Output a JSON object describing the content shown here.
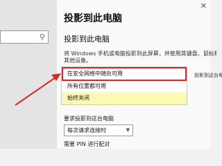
{
  "main": {
    "page_title": "投影到此电脑",
    "section_title": "投影到此电脑",
    "description_line1": "将 Windows 手机或电脑投影到此屏幕，并使用其键盘、鼠标和",
    "description_line2": "其他设备。",
    "right_clipped_text": "投影到这台电"
  },
  "dropdown": {
    "options": [
      "在安全网络中随处可用",
      "所有位置都可用",
      "始终关闭"
    ]
  },
  "request": {
    "label": "要求投影到这台电脑",
    "select_value": "每次请求连接时"
  },
  "pin": {
    "label": "需要 PIN 进行配对"
  },
  "colors": {
    "highlight_border": "#e02323",
    "hover_option": "#fafab4"
  }
}
